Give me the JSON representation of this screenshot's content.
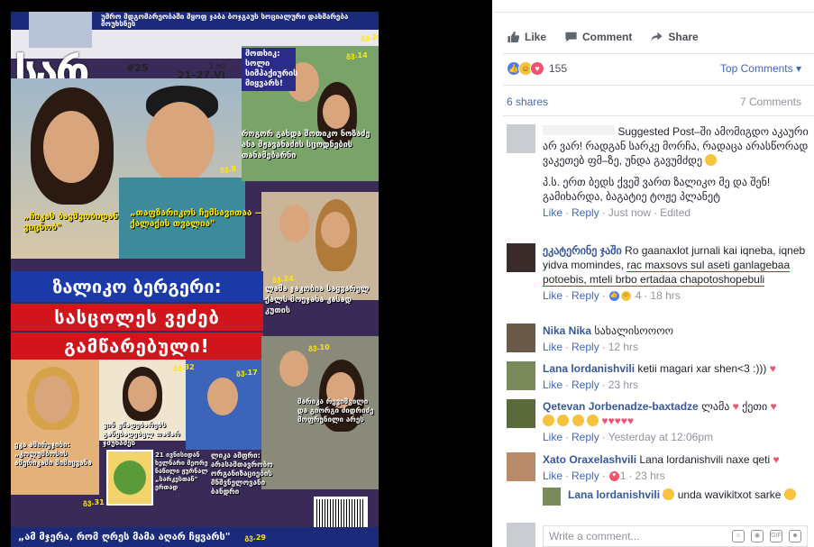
{
  "cover": {
    "top_strip": "უმრო მდგომარეობაში მყოფ ჯაბა ბოჯგაუს სოციალური დახმარება მოუხსნეს",
    "logo": "სარ",
    "issue_number": "#25",
    "price": "1.50",
    "dates": "21–27.VI",
    "year": "2017",
    "headline_top_right": "მოთხიკ: სოლი სიმპაქიურის მიყვარს!",
    "caption_couple": "როგორ გახდა შოთიკო ნოზაძე ანა მჟავანაძის სცოდნების თანამებარნი",
    "quote_left": "„ჩიკას ბავშვობიდან ვიცნობ\"",
    "quote_center": "„თაფზარიკოს ჩემსავითაა — ქალაქის თვალია\"",
    "main_title": "ზალიკო ბერგერი:",
    "main_sub_1": "სასცოლეს ვეძებ",
    "main_sub_2": "გამწარებული!",
    "caption_lasha": "ლაშა ჯაკობია საყვარელ ქალს მოეჯახა კასად კუთის",
    "caption_left_bottom": "ეკა ამირეჯიბი: „კოლუმბოსის ამერიკაში მიმიყვანა",
    "caption_woman_mid": "ვინ უწადებარებს განებადებულ თამარ ჯმუხაძეს",
    "caption_book": "21 ივნისიდან ხელნარი მეორე ნაწილი ჟურნალ „სარკესთან\" ერთად",
    "caption_lika": "ლიკა ამფრი: არასამთავრობო ორგანიზაციების მნშვნელოვანი ბანდრი",
    "caption_right": "მარიკა რევიშვილი და გიორგი ძიდრიძე მოფრენილი არეს",
    "footer": "„ამ მჯერა, რომ ღრეს მამა აღარ ჩყვარს\"",
    "pages": [
      "გვ.20",
      "გვ.14",
      "გვ.8",
      "გვ.24",
      "გვ.10",
      "გვ.32",
      "გვ.17",
      "გვ.31",
      "გვ.29"
    ]
  },
  "post_actions": {
    "like": "Like",
    "comment": "Comment",
    "share": "Share"
  },
  "reactions": {
    "count": "155",
    "sort_label": "Top Comments ▾"
  },
  "stats": {
    "shares": "6 shares",
    "comments": "7 Comments"
  },
  "comments": [
    {
      "name": "",
      "badge": "Suggested Post",
      "text": "–ში ამომიგდო აკაური არ ვარ! რადგან სარკე მორჩა, რადაცა არასწორად ვაკეთებ ფმ–ზე, უნდა გავუმძდე",
      "text2": "პ.ს. ერთ ბედს ქვეშ ვართ ზალიკო მე და შენ! გამიხარდა, ბაგატიე ტოჟე პლანეტ",
      "like": "Like",
      "reply": "Reply",
      "time": "Just now",
      "edited": "Edited"
    },
    {
      "name": "ეკატერინე ჯაში",
      "text_plain": "Ro gaanaxlot jurnali kai iqneba, iqneb yidva momindes, ",
      "text_marked": "rac maxsovs sul aseti ganlagebaa potoebis, mteli brbo ertadaa chapotoshopebuli",
      "like": "Like",
      "reply": "Reply",
      "reaction_count": "4",
      "time": "18 hrs"
    },
    {
      "name": "Nika Nika",
      "text": "სახალისოოოო",
      "like": "Like",
      "reply": "Reply",
      "time": "12 hrs"
    },
    {
      "name": "Lana lordanishvili",
      "text": "ketii magari xar shen<3 :)))",
      "like": "Like",
      "reply": "Reply",
      "time": "23 hrs"
    },
    {
      "name": "Qetevan Jorbenadze-baxtadze",
      "text": "ლამა",
      "text2": "ქეთი",
      "like": "Like",
      "reply": "Reply",
      "time": "Yesterday at 12:06pm"
    },
    {
      "name": "Xato Oraxelashvili",
      "text": "Lana lordanishvili naxe qeti",
      "like": "Like",
      "reply": "Reply",
      "reaction_count": "1",
      "time": "23 hrs"
    },
    {
      "name": "Lana lordanishvili",
      "text": "unda wavikitxot sarke"
    }
  ],
  "composer": {
    "placeholder": "Write a comment..."
  },
  "colors": {
    "fb_blue": "#4267b2",
    "name_blue": "#365899",
    "meta_grey": "#90949c",
    "highlight_red": "#e01c2a"
  }
}
